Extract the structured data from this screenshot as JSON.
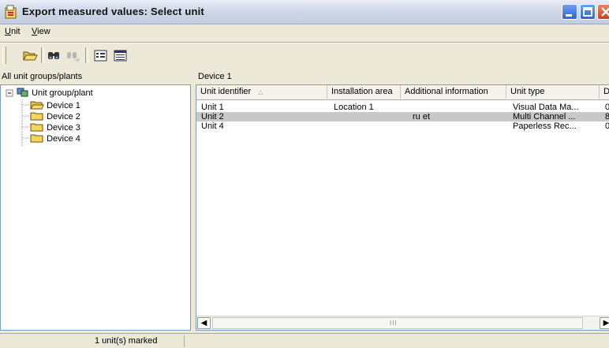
{
  "window": {
    "title": "Export measured values: Select unit"
  },
  "menu": [
    {
      "label": "nit",
      "accel": "U"
    },
    {
      "label": "iew",
      "accel": "V"
    }
  ],
  "toolbar": {
    "icons": [
      "open-folder-icon",
      "find-icon",
      "find-next-icon",
      "list-view-icon",
      "details-view-icon"
    ]
  },
  "left_pane": {
    "header": "All unit groups/plants",
    "tree": {
      "root": "Unit group/plant",
      "children": [
        "Device 1",
        "Device 2",
        "Device 3",
        "Device 4"
      ]
    }
  },
  "right_pane": {
    "header": "Device 1",
    "columns": [
      "Unit identifier",
      "Installation area",
      "Additional information",
      "Unit type",
      "D"
    ],
    "rows": [
      {
        "id": "Unit 1",
        "area": "Location 1",
        "info": "",
        "type": "Visual Data Ma...",
        "d": "0",
        "selected": false
      },
      {
        "id": "Unit 2",
        "area": "",
        "info": "ru et",
        "type": "Multi Channel ...",
        "d": "8",
        "selected": true
      },
      {
        "id": "Unit 4",
        "area": "",
        "info": "",
        "type": "Paperless Rec...",
        "d": "0",
        "selected": false
      }
    ]
  },
  "statusbar": {
    "left": "",
    "message": "1 unit(s) marked"
  },
  "colors": {
    "selection": "#c8c8c8",
    "window_bg": "#ece9d8",
    "title_gradient_top": "#e8edf6"
  }
}
